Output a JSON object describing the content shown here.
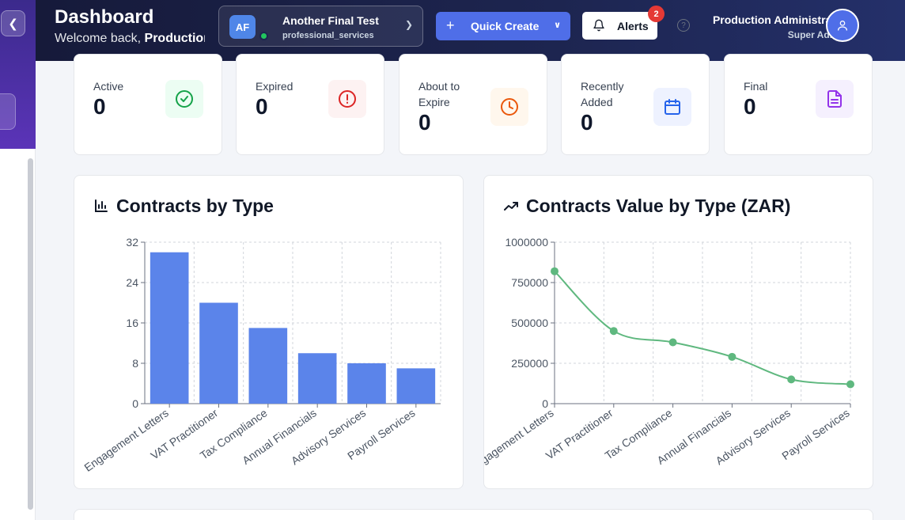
{
  "header": {
    "title": "Dashboard",
    "welcome_prefix": "Welcome back, ",
    "welcome_name": "Production Administrator"
  },
  "org": {
    "initials": "AF",
    "name": "Another Final Test",
    "type": "professional_services"
  },
  "quick_create": {
    "label": "Quick Create"
  },
  "alerts": {
    "label": "Alerts",
    "count": "2"
  },
  "user": {
    "name": "Production Administrator",
    "role": "Super Admin"
  },
  "stats": [
    {
      "label": "Active",
      "value": "0",
      "icon": "check-circle-icon",
      "color": "#16a34a",
      "bg": "#ecfdf3"
    },
    {
      "label": "Expired",
      "value": "0",
      "icon": "alert-circle-icon",
      "color": "#dc2626",
      "bg": "#fdf2f2"
    },
    {
      "label": "About to Expire",
      "value": "0",
      "icon": "clock-icon",
      "color": "#ea580c",
      "bg": "#fff7ed"
    },
    {
      "label": "Recently Added",
      "value": "0",
      "icon": "calendar-icon",
      "color": "#2563eb",
      "bg": "#eef2ff"
    },
    {
      "label": "Final",
      "value": "0",
      "icon": "file-text-icon",
      "color": "#9333ea",
      "bg": "#f5f0fe"
    }
  ],
  "chart_data": [
    {
      "type": "bar",
      "title": "Contracts by Type",
      "categories": [
        "Engagement Letters",
        "VAT Practitioner",
        "Tax Compliance",
        "Annual Financials",
        "Advisory Services",
        "Payroll Services"
      ],
      "values": [
        30,
        20,
        15,
        10,
        8,
        7
      ],
      "ylim": [
        0,
        32
      ],
      "yticks": [
        "0",
        "8",
        "16",
        "24",
        "32"
      ],
      "grid": true,
      "color": "#5b84ea"
    },
    {
      "type": "line",
      "title": "Contracts Value by Type (ZAR)",
      "categories": [
        "Engagement Letters",
        "VAT Practitioner",
        "Tax Compliance",
        "Annual Financials",
        "Advisory Services",
        "Payroll Services"
      ],
      "values": [
        820000,
        450000,
        380000,
        290000,
        150000,
        120000
      ],
      "ylim": [
        0,
        1000000
      ],
      "yticks": [
        "0",
        "250000",
        "500000",
        "750000",
        "1000000"
      ],
      "grid": true,
      "color": "#5fb87f"
    }
  ]
}
